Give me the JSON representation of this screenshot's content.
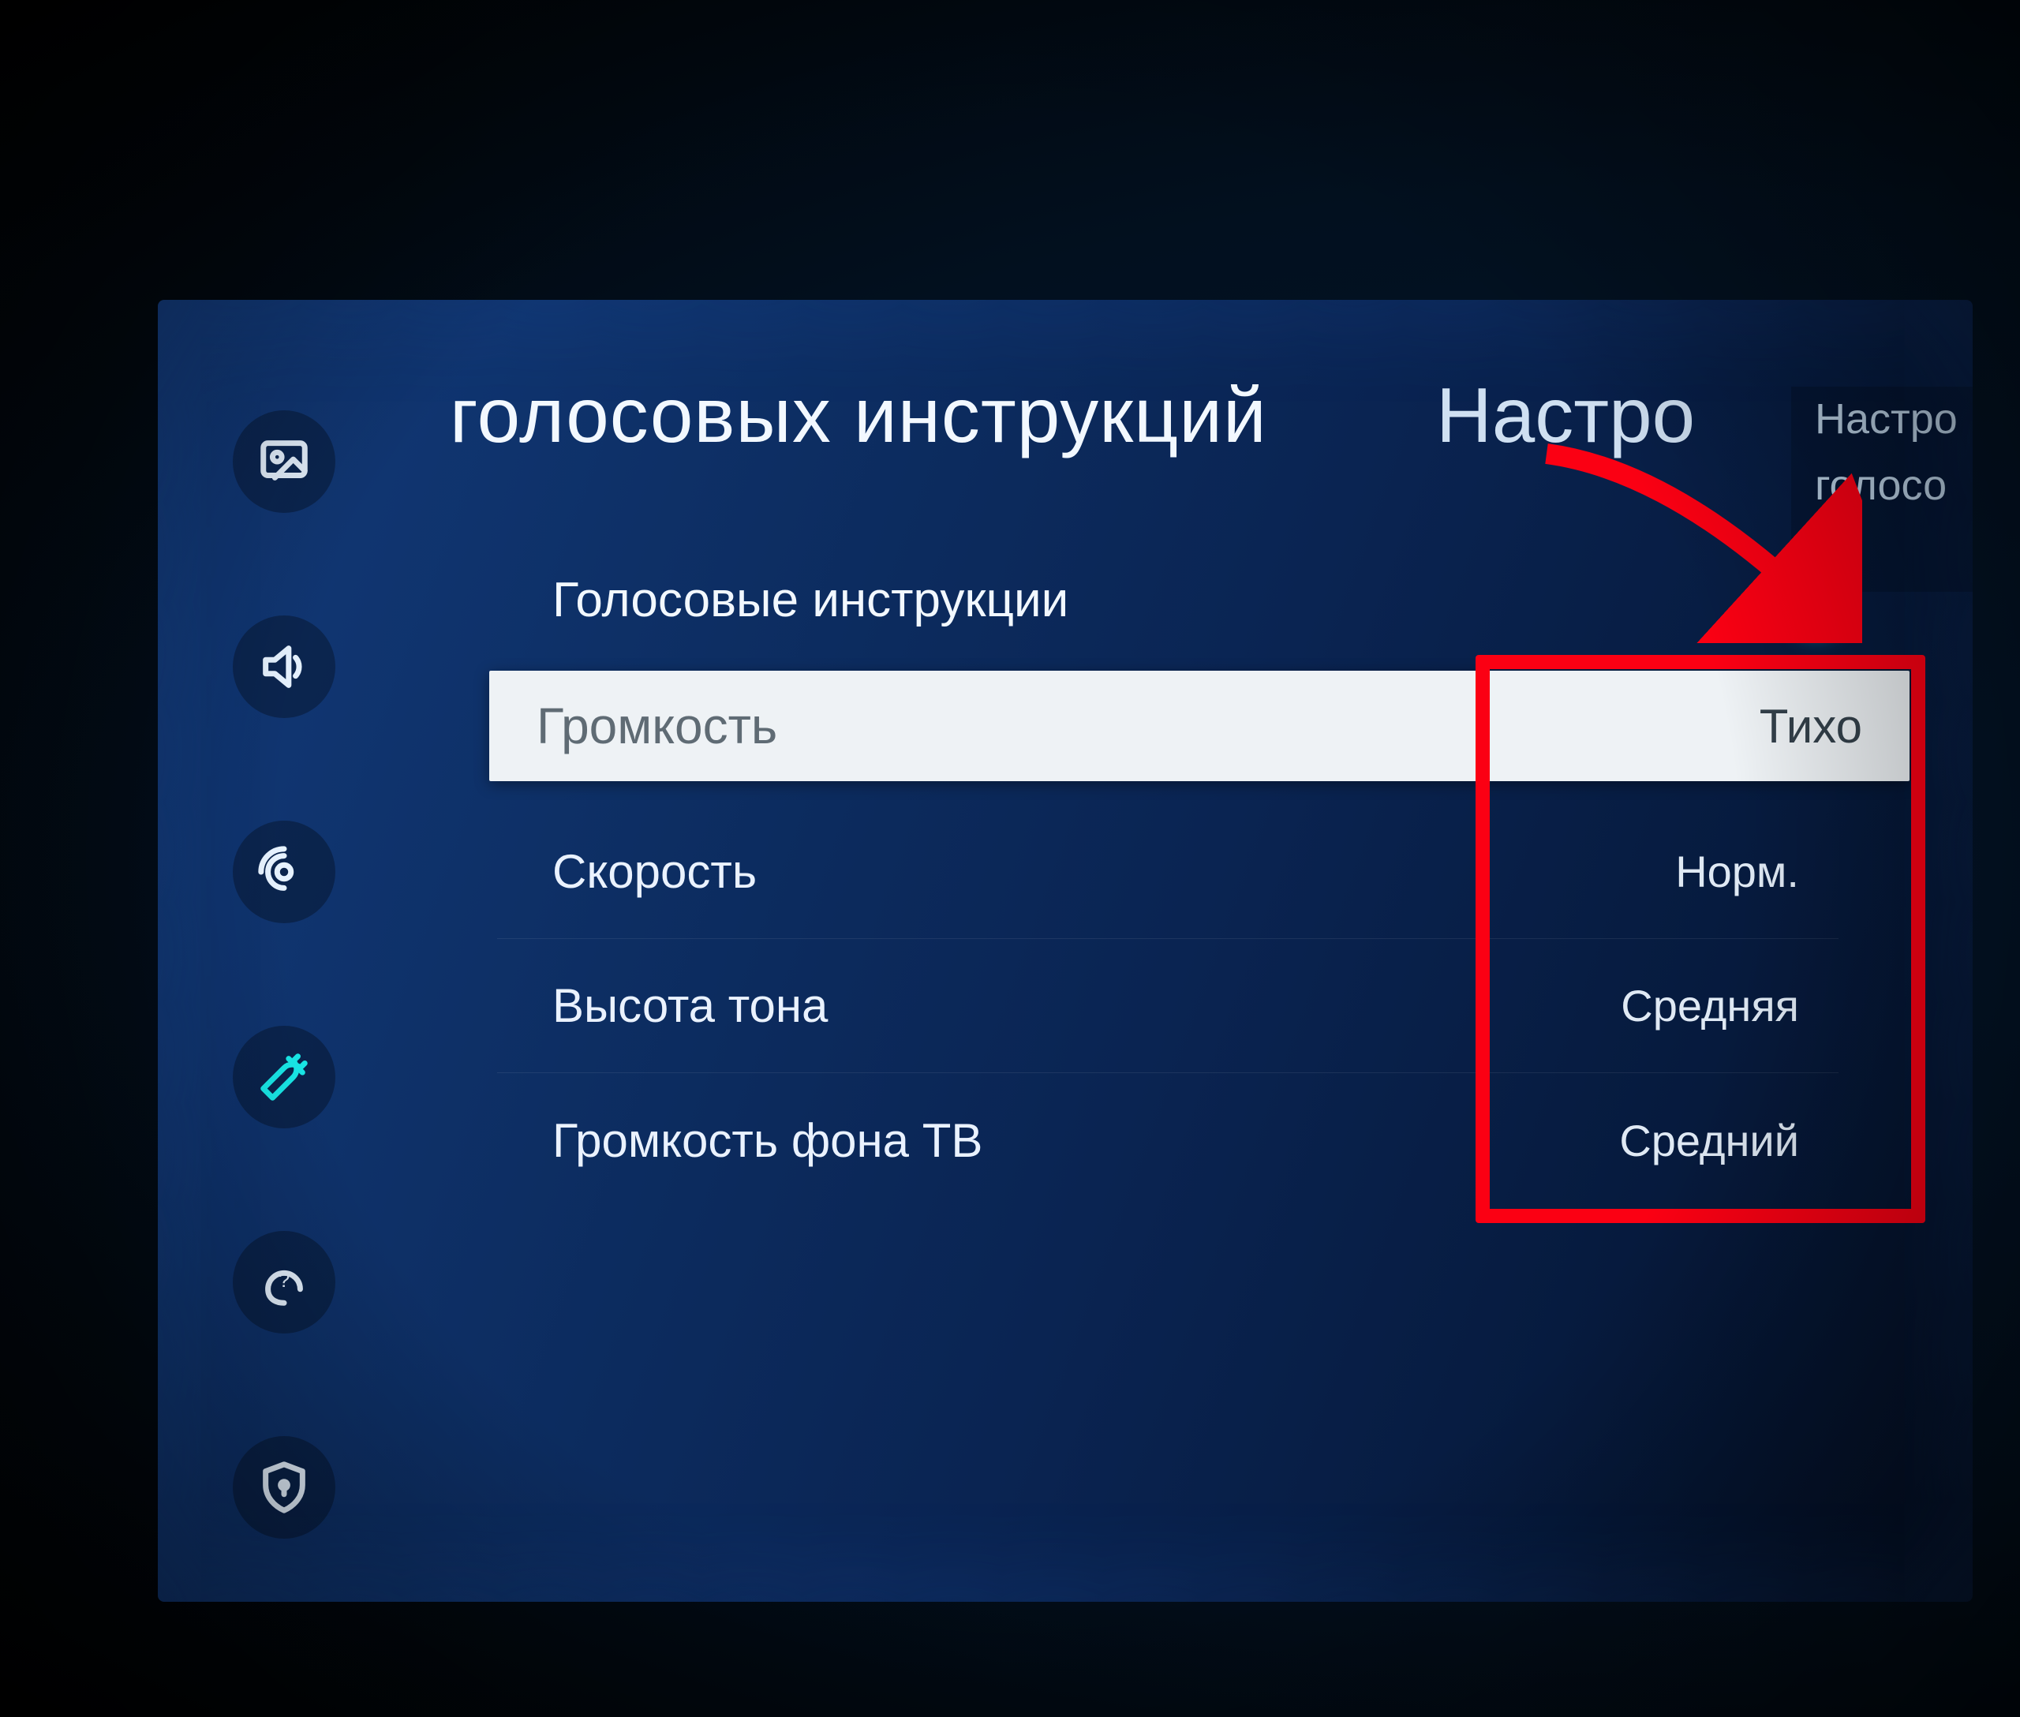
{
  "header": {
    "title_left": "голосовых инструкций",
    "title_right": "Настро"
  },
  "toggle": {
    "label": "Голосовые инструкции",
    "state": "on"
  },
  "selected_row": {
    "label": "Громкость",
    "value": "Тихо"
  },
  "rows": [
    {
      "label": "Скорость",
      "value": "Норм."
    },
    {
      "label": "Высота тона",
      "value": "Средняя"
    },
    {
      "label": "Громкость фона ТВ",
      "value": "Средний"
    }
  ],
  "side_panel": {
    "line1": "Настро",
    "line2": "голосо"
  },
  "sidebar_icons": [
    "picture-icon",
    "sound-icon",
    "broadcast-icon",
    "general-icon",
    "support-icon",
    "privacy-icon"
  ],
  "active_sidebar_index": 3
}
